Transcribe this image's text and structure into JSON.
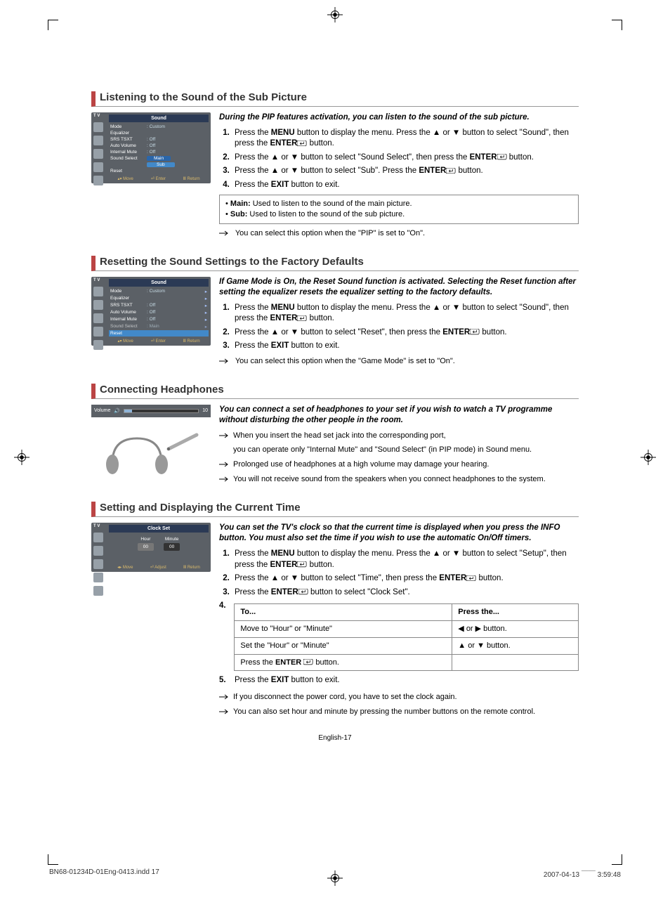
{
  "page_number_label": "English-17",
  "footer": {
    "file": "BN68-01234D-01Eng-0413.indd   17",
    "date": "2007-04-13   ￣￣ 3:59:48"
  },
  "sec1": {
    "title": "Listening to the Sound of the Sub Picture",
    "intro": "During the PIP features activation, you can listen to the sound of the sub picture.",
    "osd": {
      "title": "Sound",
      "tv": "T V",
      "rows": [
        {
          "lbl": "Mode",
          "val": ": Custom"
        },
        {
          "lbl": "Equalizer",
          "val": ""
        },
        {
          "lbl": "SRS TSXT",
          "val": ": Off"
        },
        {
          "lbl": "Auto Volume",
          "val": ": Off"
        },
        {
          "lbl": "Internal Mute",
          "val": ": Off"
        },
        {
          "lbl": "Sound Select",
          "val": "Main",
          "hl": true
        },
        {
          "lbl": "",
          "val": "Sub",
          "sub": true
        },
        {
          "lbl": "Reset",
          "val": ""
        }
      ],
      "footer": [
        "Move",
        "Enter",
        "Return"
      ]
    },
    "steps": [
      {
        "pre": "Press the ",
        "b1": "MENU",
        "mid": " button to display the menu. Press the ▲ or ▼ button to select \"Sound\", then press the ",
        "b2": "ENTER",
        "post": " button."
      },
      {
        "pre": "Press the ▲ or ▼ button to select \"Sound Select\", then press the ",
        "b1": "ENTER",
        "post": " button."
      },
      {
        "pre": "Press the ▲ or ▼ button to select \"Sub\". Press the ",
        "b1": "ENTER",
        "post": " button."
      },
      {
        "pre": "Press the ",
        "b1": "EXIT",
        "post": " button to exit."
      }
    ],
    "box": [
      {
        "b": "Main:",
        "t": " Used to listen to the sound of the main picture."
      },
      {
        "b": "Sub:",
        "t": " Used to listen to the sound of the sub picture."
      }
    ],
    "note": "You can select this option when the \"PIP\" is set to \"On\"."
  },
  "sec2": {
    "title": "Resetting the Sound Settings to the Factory Defaults",
    "intro": "If Game Mode is On, the Reset Sound function is activated. Selecting the Reset function after setting the equalizer resets the equalizer setting to the factory defaults.",
    "osd": {
      "title": "Sound",
      "tv": "T V",
      "rows": [
        {
          "lbl": "Mode",
          "val": ": Custom",
          "arr": true
        },
        {
          "lbl": "Equalizer",
          "val": "",
          "arr": true
        },
        {
          "lbl": "SRS TSXT",
          "val": ": Off",
          "arr": true
        },
        {
          "lbl": "Auto Volume",
          "val": ": Off",
          "arr": true
        },
        {
          "lbl": "Internal Mute",
          "val": ": Off",
          "arr": true
        },
        {
          "lbl": "Sound Select",
          "val": ": Main",
          "dim": true,
          "arr": true
        },
        {
          "lbl": "Reset",
          "val": "",
          "hlrow": true
        }
      ],
      "footer": [
        "Move",
        "Enter",
        "Return"
      ]
    },
    "steps": [
      {
        "pre": "Press the ",
        "b1": "MENU",
        "mid": " button to display the menu. Press the ▲ or ▼ button to select \"Sound\", then press the ",
        "b2": "ENTER",
        "post": " button."
      },
      {
        "pre": "Press the ▲ or ▼ button to select \"Reset\", then press the ",
        "b1": "ENTER",
        "post": " button."
      },
      {
        "pre": "Press the ",
        "b1": "EXIT",
        "post": " button to exit."
      }
    ],
    "note": "You can select this option when the \"Game Mode\" is set to \"On\"."
  },
  "sec3": {
    "title": "Connecting Headphones",
    "intro": "You can connect a set of headphones to your set if you wish to watch a TV programme without disturbing the other people in the room.",
    "vol_label": "Volume",
    "vol_value": "10",
    "notes": [
      "When you insert the head set jack into the corresponding port,",
      "you can operate only \"Internal Mute\" and \"Sound Select\" (in PIP mode) in Sound menu.",
      "Prolonged use of headphones at a high volume may damage your hearing.",
      "You will not receive sound from the speakers when you connect headphones to the system."
    ]
  },
  "sec4": {
    "title": "Setting and Displaying the Current Time",
    "intro": "You can set the TV's clock so that the current time is displayed when you press the INFO button. You must also set the time if you wish to use the automatic On/Off timers.",
    "osd": {
      "title": "Clock Set",
      "tv": "T V",
      "hour_lbl": "Hour",
      "min_lbl": "Minute",
      "hour_val": "00",
      "min_val": "00",
      "footer": [
        "Move",
        "Adjust",
        "Return"
      ]
    },
    "steps": [
      {
        "pre": "Press the ",
        "b1": "MENU",
        "mid": " button to display the menu. Press the ▲ or ▼ button to select \"Setup\", then press the ",
        "b2": "ENTER",
        "post": " button."
      },
      {
        "pre": "Press the ▲ or ▼ button to select \"Time\", then press the ",
        "b1": "ENTER",
        "post": " button."
      },
      {
        "pre": "Press the ",
        "b1": "ENTER",
        "post": " button to select \"Clock Set\"."
      }
    ],
    "table": {
      "h1": "To...",
      "h2": "Press the...",
      "rows": [
        {
          "a": "Move to \"Hour\" or \"Minute\"",
          "b": "◀  or  ▶ button."
        },
        {
          "a": "Set the \"Hour\" or \"Minute\"",
          "b": "▲  or  ▼ button."
        },
        {
          "a": "Press the ENTER ⏎ button.",
          "b": ""
        }
      ]
    },
    "step5": "Press the EXIT button to exit.",
    "step5_pre": "Press the ",
    "step5_b": "EXIT",
    "step5_post": " button to exit.",
    "notes": [
      "If you disconnect the power cord, you have to set the clock again.",
      "You can also set hour and minute by pressing the number buttons on the remote control."
    ]
  }
}
